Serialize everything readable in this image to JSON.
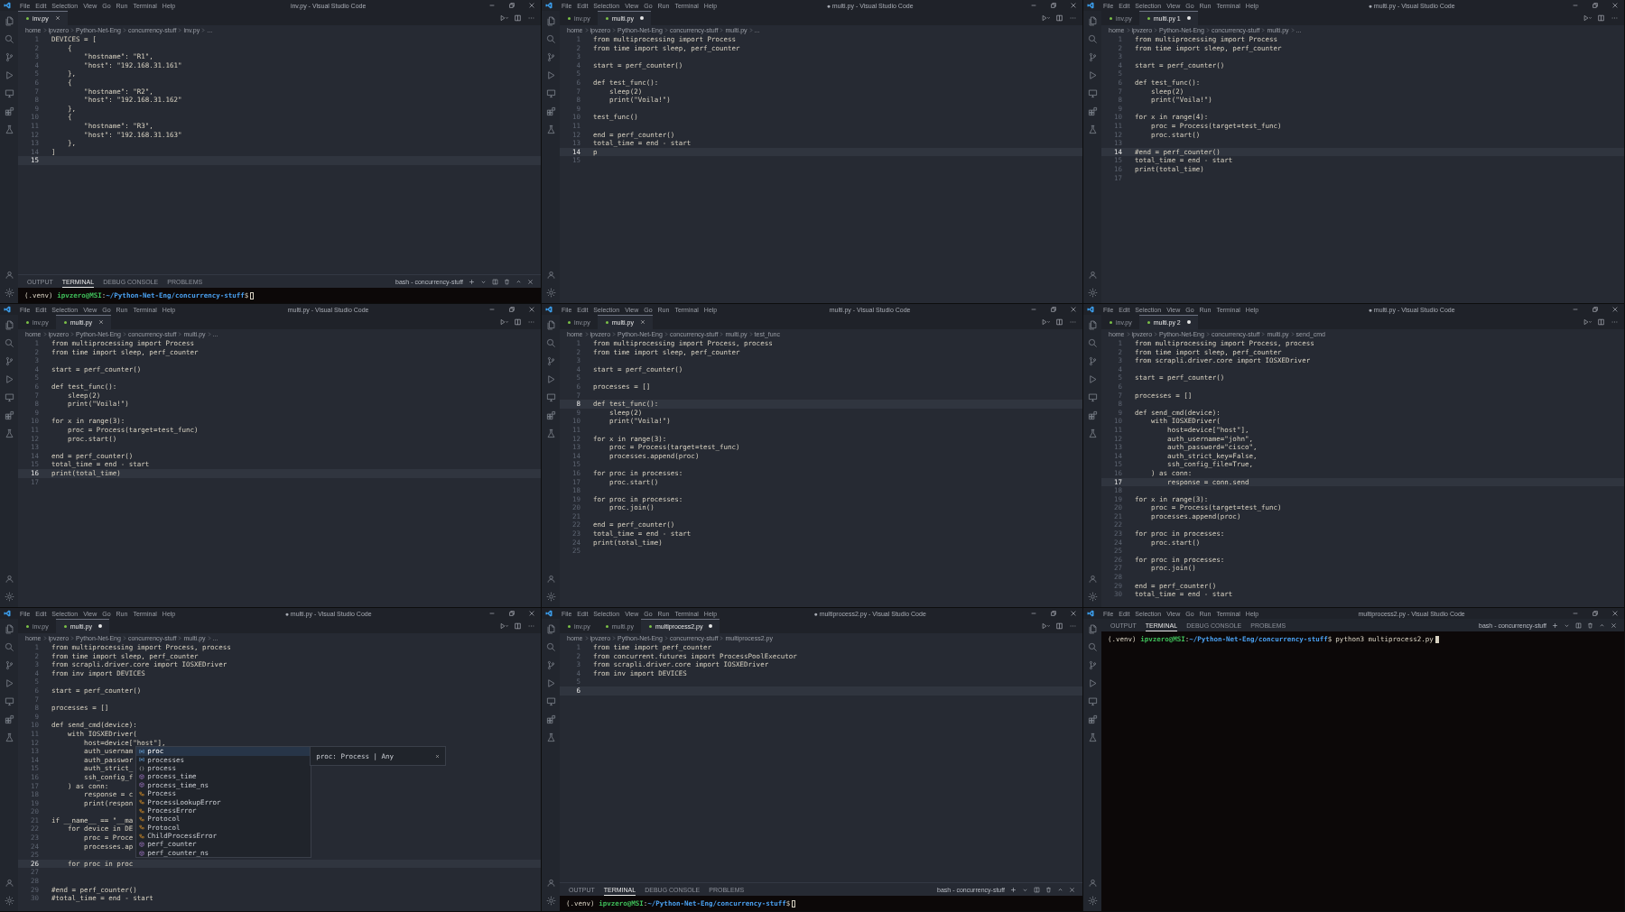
{
  "panels": [
    {
      "menu": [
        "File",
        "Edit",
        "Selection",
        "View",
        "Go",
        "Run",
        "Terminal",
        "Help"
      ],
      "title": "inv.py - Visual Studio Code",
      "tabs": [
        {
          "label": "inv.py",
          "selected": true,
          "modified": false
        }
      ],
      "breadcrumb": [
        "home",
        "ipvzero",
        "Python-Net-Eng",
        "concurrency-stuff",
        "inv.py",
        "..."
      ],
      "lines": [
        {
          "no": "1",
          "code": "DEVICES = [",
          "current": false
        },
        {
          "no": "2",
          "code": "    {",
          "current": false
        },
        {
          "no": "3",
          "code": "        \"hostname\": \"R1\",",
          "current": false
        },
        {
          "no": "4",
          "code": "        \"host\": \"192.168.31.161\"",
          "current": false
        },
        {
          "no": "5",
          "code": "    },",
          "current": false
        },
        {
          "no": "6",
          "code": "    {",
          "current": false
        },
        {
          "no": "7",
          "code": "        \"hostname\": \"R2\",",
          "current": false
        },
        {
          "no": "8",
          "code": "        \"host\": \"192.168.31.162\"",
          "current": false
        },
        {
          "no": "9",
          "code": "    },",
          "current": false
        },
        {
          "no": "10",
          "code": "    {",
          "current": false
        },
        {
          "no": "11",
          "code": "        \"hostname\": \"R3\",",
          "current": false
        },
        {
          "no": "12",
          "code": "        \"host\": \"192.168.31.163\"",
          "current": false
        },
        {
          "no": "13",
          "code": "    },",
          "current": false
        },
        {
          "no": "14",
          "code": "]",
          "current": false
        },
        {
          "no": "15",
          "current": true
        }
      ],
      "terminal": {
        "tabs": [
          {
            "label": "OUTPUT",
            "selected": false
          },
          {
            "label": "TERMINAL",
            "selected": true
          },
          {
            "label": "DEBUG CONSOLE",
            "selected": false
          },
          {
            "label": "PROBLEMS",
            "selected": false
          }
        ],
        "shell": "bash - concurrency-stuff",
        "prompt": {
          "env": "(.venv)",
          "user": "ipvzero@MSI",
          "sep": ":",
          "path": "~/Python-Net-Eng/concurrency-stuff",
          "symbol": "$"
        },
        "focused": false
      }
    },
    {
      "menu": [
        "File",
        "Edit",
        "Selection",
        "View",
        "Go",
        "Run",
        "Terminal",
        "Help"
      ],
      "title": "● multi.py - Visual Studio Code",
      "tabs": [
        {
          "label": "inv.py",
          "selected": false,
          "modified": false
        },
        {
          "label": "multi.py",
          "selected": true,
          "modified": true
        }
      ],
      "breadcrumb": [
        "home",
        "ipvzero",
        "Python-Net-Eng",
        "concurrency-stuff",
        "multi.py",
        "..."
      ],
      "lines": [
        {
          "no": "1",
          "code": "from multiprocessing import Process",
          "current": false
        },
        {
          "no": "2",
          "code": "from time import sleep, perf_counter",
          "current": false
        },
        {
          "no": "3",
          "current": false
        },
        {
          "no": "4",
          "code": "start = perf_counter()",
          "current": false
        },
        {
          "no": "5",
          "current": false
        },
        {
          "no": "6",
          "code": "def test_func():",
          "current": false
        },
        {
          "no": "7",
          "code": "    sleep(2)",
          "current": false
        },
        {
          "no": "8",
          "code": "    print(\"Voila!\")",
          "current": false
        },
        {
          "no": "9",
          "current": false
        },
        {
          "no": "10",
          "code": "test_func()",
          "current": false
        },
        {
          "no": "11",
          "current": false
        },
        {
          "no": "12",
          "code": "end = perf_counter()",
          "current": false
        },
        {
          "no": "13",
          "code": "total_time = end - start",
          "current": false
        },
        {
          "no": "14",
          "code": "p",
          "current": true
        },
        {
          "no": "15",
          "current": false
        }
      ]
    },
    {
      "menu": [
        "File",
        "Edit",
        "Selection",
        "View",
        "Go",
        "Run",
        "Terminal",
        "Help"
      ],
      "title": "● multi.py - Visual Studio Code",
      "tabs": [
        {
          "label": "inv.py",
          "selected": false,
          "modified": false
        },
        {
          "label": "multi.py 1",
          "selected": true,
          "modified": true
        }
      ],
      "breadcrumb": [
        "home",
        "ipvzero",
        "Python-Net-Eng",
        "concurrency-stuff",
        "multi.py",
        "..."
      ],
      "lines": [
        {
          "no": "1",
          "code": "from multiprocessing import Process",
          "current": false
        },
        {
          "no": "2",
          "code": "from time import sleep, perf_counter",
          "current": false
        },
        {
          "no": "3",
          "current": false
        },
        {
          "no": "4",
          "code": "start = perf_counter()",
          "current": false
        },
        {
          "no": "5",
          "current": false
        },
        {
          "no": "6",
          "code": "def test_func():",
          "current": false
        },
        {
          "no": "7",
          "code": "    sleep(2)",
          "current": false
        },
        {
          "no": "8",
          "code": "    print(\"Voila!\")",
          "current": false
        },
        {
          "no": "9",
          "current": false
        },
        {
          "no": "10",
          "code": "for x in range(4):",
          "current": false
        },
        {
          "no": "11",
          "code": "    proc = Process(target=test_func)",
          "current": false
        },
        {
          "no": "12",
          "code": "    proc.start()",
          "current": false
        },
        {
          "no": "13",
          "current": false
        },
        {
          "no": "14",
          "code": "#end = perf_counter()",
          "current": true
        },
        {
          "no": "15",
          "code": "total_time = end - start",
          "current": false
        },
        {
          "no": "16",
          "code": "print(total_time)",
          "current": false
        },
        {
          "no": "17",
          "current": false
        }
      ]
    },
    {
      "menu": [
        "File",
        "Edit",
        "Selection",
        "View",
        "Go",
        "Run",
        "Terminal",
        "Help"
      ],
      "title": "multi.py - Visual Studio Code",
      "tabs": [
        {
          "label": "inv.py",
          "selected": false,
          "modified": false
        },
        {
          "label": "multi.py",
          "selected": true,
          "modified": false
        }
      ],
      "breadcrumb": [
        "home",
        "ipvzero",
        "Python-Net-Eng",
        "concurrency-stuff",
        "multi.py",
        "..."
      ],
      "lines": [
        {
          "no": "1",
          "code": "from multiprocessing import Process",
          "current": false
        },
        {
          "no": "2",
          "code": "from time import sleep, perf_counter",
          "current": false
        },
        {
          "no": "3",
          "current": false
        },
        {
          "no": "4",
          "code": "start = perf_counter()",
          "current": false
        },
        {
          "no": "5",
          "current": false
        },
        {
          "no": "6",
          "code": "def test_func():",
          "current": false
        },
        {
          "no": "7",
          "code": "    sleep(2)",
          "current": false
        },
        {
          "no": "8",
          "code": "    print(\"Voila!\")",
          "current": false
        },
        {
          "no": "9",
          "current": false
        },
        {
          "no": "10",
          "code": "for x in range(3):",
          "current": false
        },
        {
          "no": "11",
          "code": "    proc = Process(target=test_func)",
          "current": false
        },
        {
          "no": "12",
          "code": "    proc.start()",
          "current": false
        },
        {
          "no": "13",
          "current": false
        },
        {
          "no": "14",
          "code": "end = perf_counter()",
          "current": false
        },
        {
          "no": "15",
          "code": "total_time = end - start",
          "current": false
        },
        {
          "no": "16",
          "code": "print(total_time)",
          "current": true
        },
        {
          "no": "17",
          "current": false
        }
      ]
    },
    {
      "menu": [
        "File",
        "Edit",
        "Selection",
        "View",
        "Go",
        "Run",
        "Terminal",
        "Help"
      ],
      "title": "multi.py - Visual Studio Code",
      "tabs": [
        {
          "label": "inv.py",
          "selected": false,
          "modified": false
        },
        {
          "label": "multi.py",
          "selected": true,
          "modified": false
        }
      ],
      "breadcrumb": [
        "home",
        "ipvzero",
        "Python-Net-Eng",
        "concurrency-stuff",
        "multi.py",
        "test_func"
      ],
      "lines": [
        {
          "no": "1",
          "code": "from multiprocessing import Process, process",
          "current": false
        },
        {
          "no": "2",
          "code": "from time import sleep, perf_counter",
          "current": false
        },
        {
          "no": "3",
          "current": false
        },
        {
          "no": "4",
          "code": "start = perf_counter()",
          "current": false
        },
        {
          "no": "5",
          "current": false
        },
        {
          "no": "6",
          "code": "processes = []",
          "current": false
        },
        {
          "no": "7",
          "current": false
        },
        {
          "no": "8",
          "code": "def test_func():",
          "current": true
        },
        {
          "no": "9",
          "code": "    sleep(2)",
          "current": false
        },
        {
          "no": "10",
          "code": "    print(\"Voila!\")",
          "current": false
        },
        {
          "no": "11",
          "current": false
        },
        {
          "no": "12",
          "code": "for x in range(3):",
          "current": false
        },
        {
          "no": "13",
          "code": "    proc = Process(target=test_func)",
          "current": false
        },
        {
          "no": "14",
          "code": "    processes.append(proc)",
          "current": false
        },
        {
          "no": "15",
          "current": false
        },
        {
          "no": "16",
          "code": "for proc in processes:",
          "current": false
        },
        {
          "no": "17",
          "code": "    proc.start()",
          "current": false
        },
        {
          "no": "18",
          "current": false
        },
        {
          "no": "19",
          "code": "for proc in processes:",
          "current": false
        },
        {
          "no": "20",
          "code": "    proc.join()",
          "current": false
        },
        {
          "no": "21",
          "current": false
        },
        {
          "no": "22",
          "code": "end = perf_counter()",
          "current": false
        },
        {
          "no": "23",
          "code": "total_time = end - start",
          "current": false
        },
        {
          "no": "24",
          "code": "print(total_time)",
          "current": false
        },
        {
          "no": "25",
          "current": false
        }
      ]
    },
    {
      "menu": [
        "File",
        "Edit",
        "Selection",
        "View",
        "Go",
        "Run",
        "Terminal",
        "Help"
      ],
      "title": "● multi.py - Visual Studio Code",
      "tabs": [
        {
          "label": "inv.py",
          "selected": false,
          "modified": false
        },
        {
          "label": "multi.py 2",
          "selected": true,
          "modified": true
        }
      ],
      "breadcrumb": [
        "home",
        "ipvzero",
        "Python-Net-Eng",
        "concurrency-stuff",
        "multi.py",
        "send_cmd"
      ],
      "lines": [
        {
          "no": "1",
          "code": "from multiprocessing import Process, process",
          "current": false
        },
        {
          "no": "2",
          "code": "from time import sleep, perf_counter",
          "current": false
        },
        {
          "no": "3",
          "code": "from scrapli.driver.core import IOSXEDriver",
          "current": false
        },
        {
          "no": "4",
          "current": false
        },
        {
          "no": "5",
          "code": "start = perf_counter()",
          "current": false
        },
        {
          "no": "6",
          "current": false
        },
        {
          "no": "7",
          "code": "processes = []",
          "current": false
        },
        {
          "no": "8",
          "current": false
        },
        {
          "no": "9",
          "code": "def send_cmd(device):",
          "current": false
        },
        {
          "no": "10",
          "code": "    with IOSXEDriver(",
          "current": false
        },
        {
          "no": "11",
          "code": "        host=device[\"host\"],",
          "current": false
        },
        {
          "no": "12",
          "code": "        auth_username=\"john\",",
          "current": false
        },
        {
          "no": "13",
          "code": "        auth_password=\"cisco\",",
          "current": false
        },
        {
          "no": "14",
          "code": "        auth_strict_key=False,",
          "current": false
        },
        {
          "no": "15",
          "code": "        ssh_config_file=True,",
          "current": false
        },
        {
          "no": "16",
          "code": "    ) as conn:",
          "current": false
        },
        {
          "no": "17",
          "code": "        response = conn.send",
          "current": true
        },
        {
          "no": "18",
          "current": false
        },
        {
          "no": "19",
          "code": "for x in range(3):",
          "current": false
        },
        {
          "no": "20",
          "code": "    proc = Process(target=test_func)",
          "current": false
        },
        {
          "no": "21",
          "code": "    processes.append(proc)",
          "current": false
        },
        {
          "no": "22",
          "current": false
        },
        {
          "no": "23",
          "code": "for proc in processes:",
          "current": false
        },
        {
          "no": "24",
          "code": "    proc.start()",
          "current": false
        },
        {
          "no": "25",
          "current": false
        },
        {
          "no": "26",
          "code": "for proc in processes:",
          "current": false
        },
        {
          "no": "27",
          "code": "    proc.join()",
          "current": false
        },
        {
          "no": "28",
          "current": false
        },
        {
          "no": "29",
          "code": "end = perf_counter()",
          "current": false
        },
        {
          "no": "30",
          "code": "total_time = end - start",
          "current": false
        }
      ]
    },
    {
      "menu": [
        "File",
        "Edit",
        "Selection",
        "View",
        "Go",
        "Run",
        "Terminal",
        "Help"
      ],
      "title": "● multi.py - Visual Studio Code",
      "tabs": [
        {
          "label": "inv.py",
          "selected": false,
          "modified": false
        },
        {
          "label": "multi.py",
          "selected": true,
          "modified": true
        }
      ],
      "breadcrumb": [
        "home",
        "ipvzero",
        "Python-Net-Eng",
        "concurrency-stuff",
        "multi.py",
        "..."
      ],
      "lines": [
        {
          "no": "1",
          "code": "from multiprocessing import Process, process",
          "current": false
        },
        {
          "no": "2",
          "code": "from time import sleep, perf_counter",
          "current": false
        },
        {
          "no": "3",
          "code": "from scrapli.driver.core import IOSXEDriver",
          "current": false
        },
        {
          "no": "4",
          "code": "from inv import DEVICES",
          "current": false
        },
        {
          "no": "5",
          "current": false
        },
        {
          "no": "6",
          "code": "start = perf_counter()",
          "current": false
        },
        {
          "no": "7",
          "current": false
        },
        {
          "no": "8",
          "code": "processes = []",
          "current": false
        },
        {
          "no": "9",
          "current": false
        },
        {
          "no": "10",
          "code": "def send_cmd(device):",
          "current": false
        },
        {
          "no": "11",
          "code": "    with IOSXEDriver(",
          "current": false
        },
        {
          "no": "12",
          "code": "        host=device[\"host\"],",
          "current": false
        },
        {
          "no": "13",
          "code": "        auth_usernam",
          "current": false
        },
        {
          "no": "14",
          "code": "        auth_passwor",
          "current": false
        },
        {
          "no": "15",
          "code": "        auth_strict_",
          "current": false
        },
        {
          "no": "16",
          "code": "        ssh_config_f",
          "current": false
        },
        {
          "no": "17",
          "code": "    ) as conn:",
          "current": false
        },
        {
          "no": "18",
          "code": "        response = c",
          "current": false
        },
        {
          "no": "19",
          "code": "        print(respon",
          "current": false
        },
        {
          "no": "20",
          "current": false
        },
        {
          "no": "21",
          "code": "if __name__ == \"__ma",
          "current": false
        },
        {
          "no": "22",
          "code": "    for device in DE",
          "current": false
        },
        {
          "no": "23",
          "code": "        proc = Proce",
          "current": false
        },
        {
          "no": "24",
          "code": "        processes.ap",
          "current": false
        },
        {
          "no": "25",
          "current": false
        },
        {
          "no": "26",
          "code": "    for proc in proc",
          "current": true
        },
        {
          "no": "27",
          "current": false
        },
        {
          "no": "28",
          "current": false
        },
        {
          "no": "29",
          "code": "#end = perf_counter()",
          "current": false
        },
        {
          "no": "30",
          "code": "#total_time = end - start",
          "current": false
        }
      ],
      "completion": {
        "items": [
          {
            "label": "proc",
            "kind": "variable",
            "selected": true
          },
          {
            "label": "processes",
            "kind": "variable",
            "selected": false
          },
          {
            "label": "process",
            "kind": "module",
            "selected": false
          },
          {
            "label": "process_time",
            "kind": "function",
            "selected": false
          },
          {
            "label": "process_time_ns",
            "kind": "function",
            "selected": false
          },
          {
            "label": "Process",
            "kind": "class",
            "selected": false
          },
          {
            "label": "ProcessLookupError",
            "kind": "class",
            "selected": false
          },
          {
            "label": "ProcessError",
            "kind": "class",
            "selected": false
          },
          {
            "label": "Protocol",
            "kind": "class",
            "selected": false
          },
          {
            "label": "Protocol",
            "kind": "class",
            "selected": false
          },
          {
            "label": "ChildProcessError",
            "kind": "class",
            "selected": false
          },
          {
            "label": "perf_counter",
            "kind": "function",
            "selected": false
          },
          {
            "label": "perf_counter_ns",
            "kind": "function",
            "selected": false
          }
        ],
        "detail": "proc: Process | Any"
      }
    },
    {
      "menu": [
        "File",
        "Edit",
        "Selection",
        "View",
        "Go",
        "Run",
        "Terminal",
        "Help"
      ],
      "title": "● multiprocess2.py - Visual Studio Code",
      "tabs": [
        {
          "label": "inv.py",
          "selected": false,
          "modified": false
        },
        {
          "label": "multi.py",
          "selected": false,
          "modified": false
        },
        {
          "label": "multiprocess2.py",
          "selected": true,
          "modified": true
        }
      ],
      "breadcrumb": [
        "home",
        "ipvzero",
        "Python-Net-Eng",
        "concurrency-stuff",
        "multiprocess2.py"
      ],
      "lines": [
        {
          "no": "1",
          "code": "from time import perf_counter",
          "current": false
        },
        {
          "no": "2",
          "code": "from concurrent.futures import ProcessPoolExecutor",
          "current": false
        },
        {
          "no": "3",
          "code": "from scrapli.driver.core import IOSXEDriver",
          "current": false
        },
        {
          "no": "4",
          "code": "from inv import DEVICES",
          "current": false
        },
        {
          "no": "5",
          "current": false
        },
        {
          "no": "6",
          "current": true
        }
      ],
      "terminal": {
        "tabs": [
          {
            "label": "OUTPUT",
            "selected": false
          },
          {
            "label": "TERMINAL",
            "selected": true
          },
          {
            "label": "DEBUG CONSOLE",
            "selected": false
          },
          {
            "label": "PROBLEMS",
            "selected": false
          }
        ],
        "shell": "bash - concurrency-stuff",
        "prompt": {
          "env": "(.venv)",
          "user": "ipvzero@MSI",
          "sep": ":",
          "path": "~/Python-Net-Eng/concurrency-stuff",
          "symbol": "$"
        },
        "focused": false
      }
    },
    {
      "menu": [
        "File",
        "Edit",
        "Selection",
        "View",
        "Go",
        "Run",
        "Terminal",
        "Help"
      ],
      "title": "multiprocess2.py - Visual Studio Code",
      "terminal": {
        "tabs": [
          {
            "label": "OUTPUT",
            "selected": false
          },
          {
            "label": "TERMINAL",
            "selected": true
          },
          {
            "label": "DEBUG CONSOLE",
            "selected": false
          },
          {
            "label": "PROBLEMS",
            "selected": false
          }
        ],
        "shell": "bash - concurrency-stuff",
        "prompt": {
          "env": "(.venv)",
          "user": "ipvzero@MSI",
          "sep": ":",
          "path": "~/Python-Net-Eng/concurrency-stuff",
          "symbol": "$"
        },
        "command": "python3 multiprocess2.py",
        "focused": true
      }
    }
  ]
}
